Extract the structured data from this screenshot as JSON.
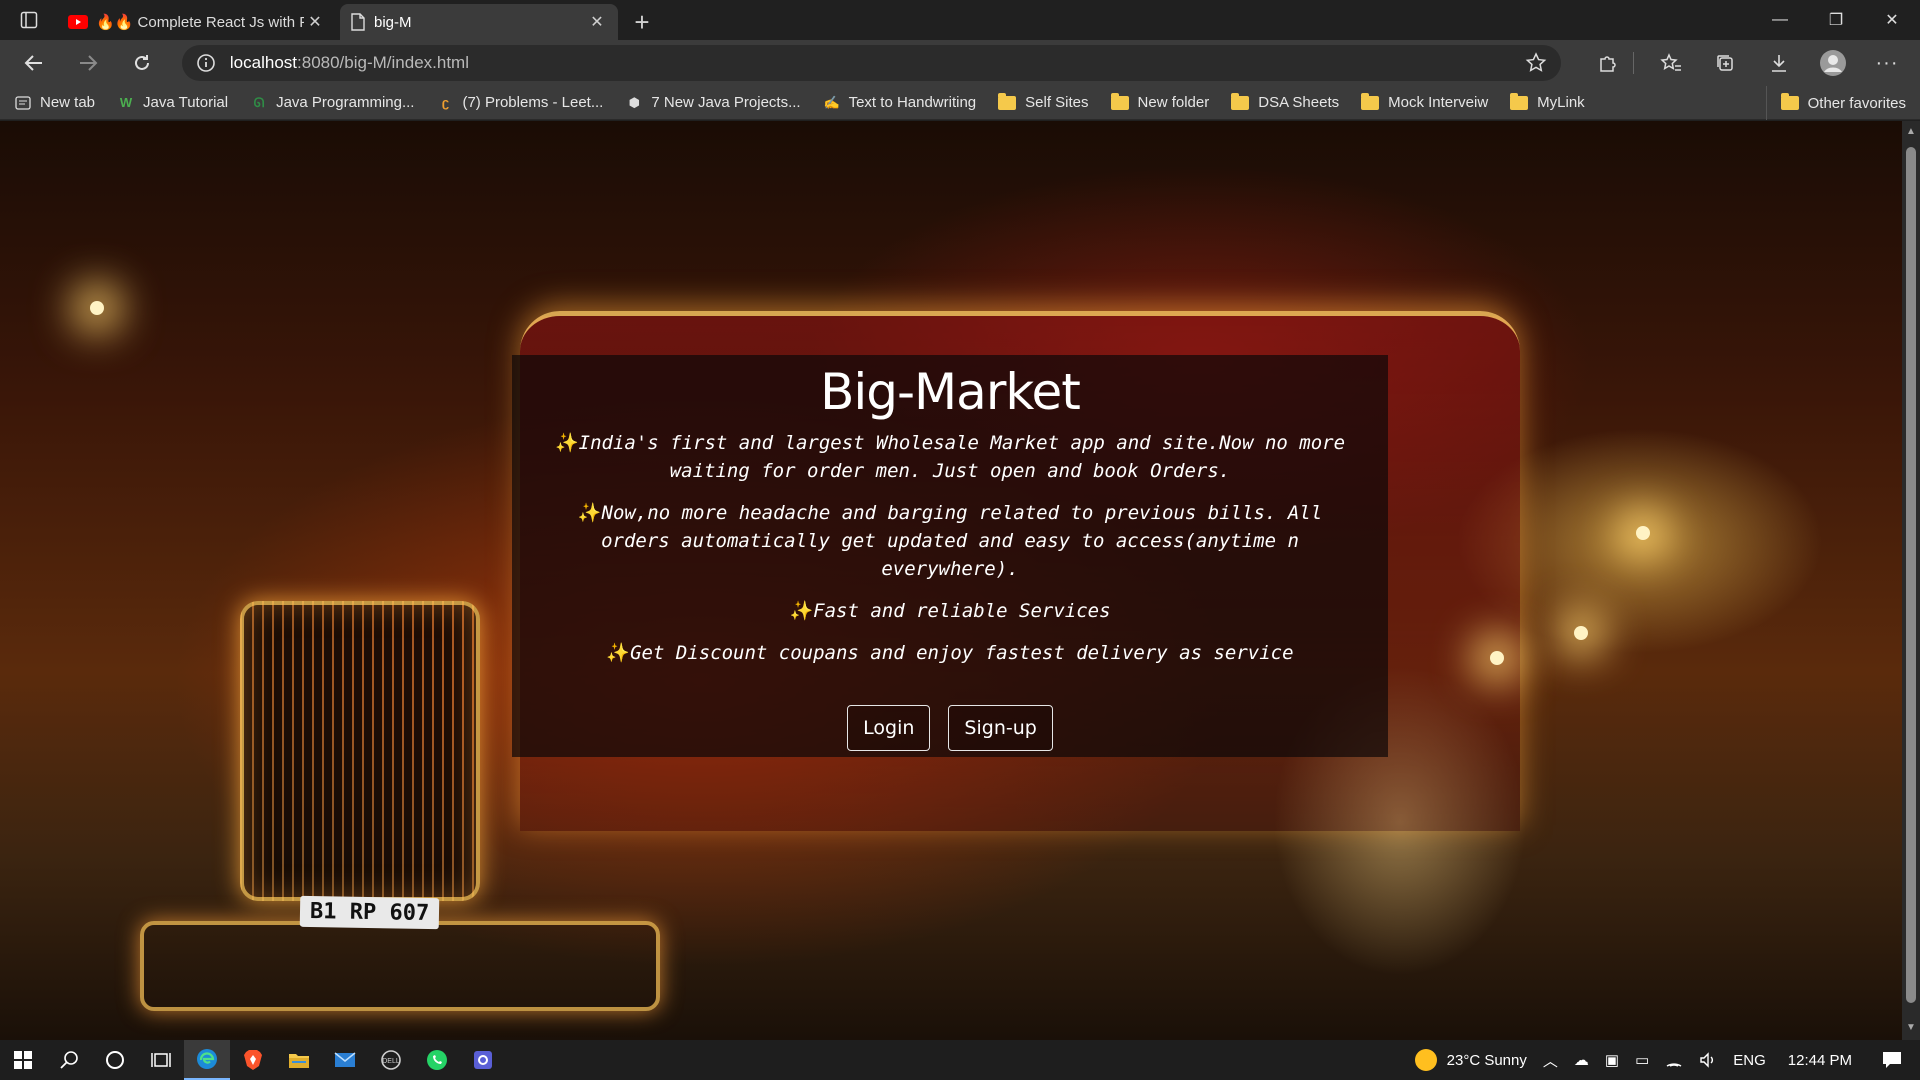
{
  "browser": {
    "tabs": [
      {
        "title": "🔥🔥 Complete React Js with Pr",
        "icon": "youtube-icon",
        "active": false
      },
      {
        "title": "big-M",
        "icon": "page-icon",
        "active": true
      }
    ],
    "address": {
      "host": "localhost",
      "rest": ":8080/big-M/index.html"
    },
    "favorites": [
      {
        "label": "New tab",
        "icon": "newtab-icon"
      },
      {
        "label": "Java Tutorial",
        "icon": "w3-icon"
      },
      {
        "label": "Java Programming...",
        "icon": "gfg-icon"
      },
      {
        "label": "(7) Problems - Leet...",
        "icon": "leetcode-icon"
      },
      {
        "label": "7 New Java Projects...",
        "icon": "site-icon"
      },
      {
        "label": "Text to Handwriting",
        "icon": "hand-icon"
      },
      {
        "label": "Self Sites",
        "icon": "folder-icon"
      },
      {
        "label": "New folder",
        "icon": "folder-icon"
      },
      {
        "label": "DSA Sheets",
        "icon": "folder-icon"
      },
      {
        "label": "Mock Interveiw",
        "icon": "folder-icon"
      },
      {
        "label": "MyLink",
        "icon": "folder-icon"
      }
    ],
    "other_favorites": "Other favorites"
  },
  "page": {
    "title": "Big-Market",
    "spark": "✨",
    "paragraphs": [
      "India's first and largest Wholesale Market app and site.Now no more waiting for order men. Just open and book Orders.",
      "Now,no more headache and barging related to previous bills. All orders automatically get updated and easy to access(anytime n everywhere).",
      "Fast and reliable Services",
      "Get Discount coupans and enjoy fastest delivery as service"
    ],
    "login_label": "Login",
    "signup_label": "Sign-up",
    "plate_text": "B1 RP 607"
  },
  "taskbar": {
    "weather": "23°C  Sunny",
    "lang": "ENG",
    "time": "12:44 PM"
  },
  "colors": {
    "accent": "#7ab7ff",
    "spark": "#ffd84a",
    "folder": "#f5c94b"
  }
}
